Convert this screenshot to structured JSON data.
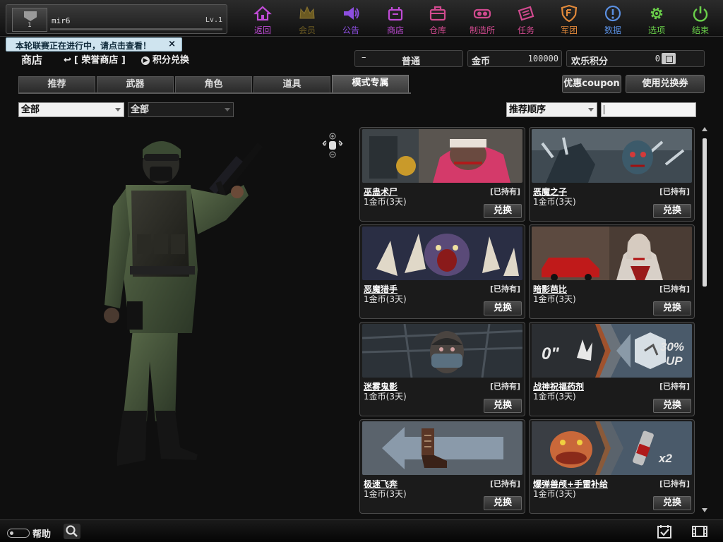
{
  "player": {
    "rank": "1",
    "name": "mir6",
    "level": "Lv.1"
  },
  "nav": [
    {
      "label": "返回",
      "icon": "home-icon",
      "color": "#c04bd6"
    },
    {
      "label": "会员",
      "icon": "crown-icon",
      "color": "#6b5a22"
    },
    {
      "label": "公告",
      "icon": "megaphone-icon",
      "color": "#8d4ee0"
    },
    {
      "label": "商店",
      "icon": "shop-icon",
      "color": "#c04bd6"
    },
    {
      "label": "仓库",
      "icon": "bag-icon",
      "color": "#d14a8f"
    },
    {
      "label": "制造所",
      "icon": "goggles-icon",
      "color": "#d14a8f"
    },
    {
      "label": "任务",
      "icon": "ticket-icon",
      "color": "#d14a8f"
    },
    {
      "label": "军团",
      "icon": "shield-icon",
      "color": "#e2893a"
    },
    {
      "label": "数据",
      "icon": "info-icon",
      "color": "#5a8fe0"
    },
    {
      "label": "选项",
      "icon": "gear-icon",
      "color": "#6ad04a"
    },
    {
      "label": "结束",
      "icon": "power-icon",
      "color": "#6ad04a"
    }
  ],
  "notice": {
    "text": "本轮联赛正在进行中，请点击查看！",
    "close": "×"
  },
  "header": {
    "title": "商店",
    "honor_shop": "[ 荣誉商店 ]",
    "points_exchange": "积分兑换",
    "mode_dash": "–",
    "mode_value": "普通",
    "gold_label": "金币",
    "gold_value": "100000",
    "fun_points_label": "欢乐积分",
    "fun_points_value": "0"
  },
  "tabs": [
    {
      "label": "推荐"
    },
    {
      "label": "武器"
    },
    {
      "label": "角色"
    },
    {
      "label": "道具"
    },
    {
      "label": "模式专属",
      "active": true
    }
  ],
  "buttons": {
    "coupon": "优惠coupon",
    "redeem": "使用兑换券"
  },
  "filters": {
    "filter1": "全部",
    "filter2": "全部",
    "sort": "推荐顺序",
    "search_value": ""
  },
  "items": [
    {
      "name": "巫蛊术尸",
      "owned": "[已持有]",
      "price": "1金币(3天)",
      "action": "兑换"
    },
    {
      "name": "恶魔之子",
      "owned": "[已持有]",
      "price": "1金币(3天)",
      "action": "兑换"
    },
    {
      "name": "恶魔猎手",
      "owned": "[已持有]",
      "price": "1金币(3天)",
      "action": "兑换"
    },
    {
      "name": "暗影芭比",
      "owned": "[已持有]",
      "price": "1金币(3天)",
      "action": "兑换"
    },
    {
      "name": "迷雾鬼影",
      "owned": "[已持有]",
      "price": "1金币(3天)",
      "action": "兑换"
    },
    {
      "name": "战神祝福药剂",
      "owned": "[已持有]",
      "price": "1金币(3天)",
      "action": "兑换",
      "thumb_text_left": "0\"",
      "thumb_text_right": "30%",
      "thumb_text_right2": "UP"
    },
    {
      "name": "极速飞奔",
      "owned": "[已持有]",
      "price": "1金币(3天)",
      "action": "兑换"
    },
    {
      "name": "爆弹兽颅+手雷补给",
      "owned": "[已持有]",
      "price": "1金币(3天)",
      "action": "兑换",
      "thumb_text_right": "x2"
    }
  ],
  "bottom": {
    "help": "帮助"
  }
}
